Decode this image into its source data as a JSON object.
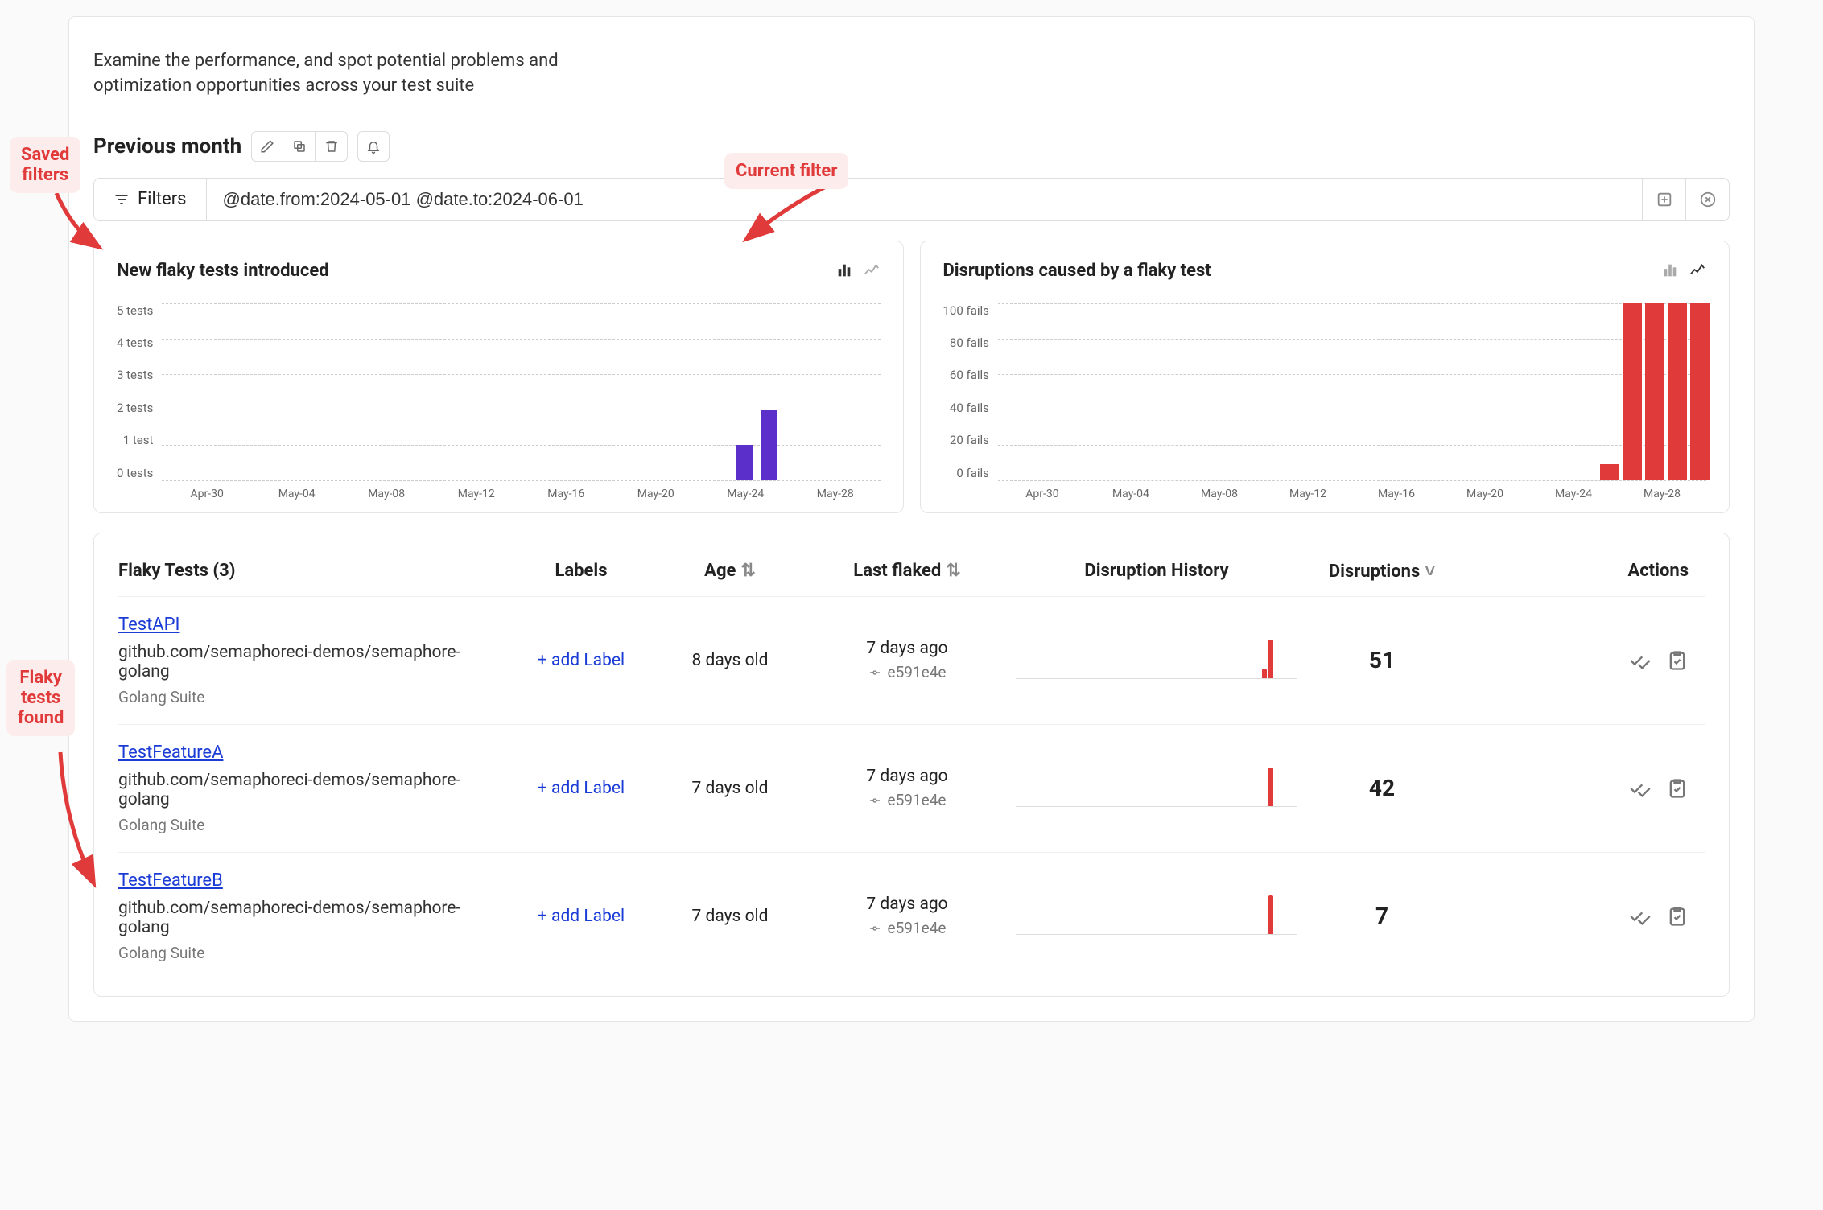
{
  "annotations": {
    "saved_filters": "Saved\nfilters",
    "current_filter": "Current filter",
    "flaky_tests_found": "Flaky\ntests\nfound"
  },
  "intro": "Examine the performance, and spot potential problems and optimization opportunities across your test suite",
  "saved_filter_name": "Previous month",
  "filter_button_label": "Filters",
  "filter_query": "@date.from:2024-05-01 @date.to:2024-06-01",
  "charts": [
    {
      "title": "New flaky tests introduced",
      "active_view": "bar",
      "chart_data": {
        "type": "bar",
        "yticks": [
          "5 tests",
          "4 tests",
          "3 tests",
          "2 tests",
          "1 test",
          "0 tests"
        ],
        "ymax": 5,
        "x_ticks": [
          "Apr-30",
          "May-04",
          "May-08",
          "May-12",
          "May-16",
          "May-20",
          "May-24",
          "May-28"
        ],
        "color": "#5b2fc9",
        "bars": [
          {
            "x_label": "May-27",
            "value": 1
          },
          {
            "x_label": "May-28",
            "value": 2
          }
        ]
      }
    },
    {
      "title": "Disruptions caused by a flaky test",
      "active_view": "line",
      "chart_data": {
        "type": "bar",
        "yticks": [
          "100 fails",
          "80 fails",
          "60 fails",
          "40 fails",
          "20 fails",
          "0 fails"
        ],
        "ymax": 100,
        "x_ticks": [
          "Apr-30",
          "May-04",
          "May-08",
          "May-12",
          "May-16",
          "May-20",
          "May-24",
          "May-28"
        ],
        "color": "#e03a3a",
        "bars": [
          {
            "x_label": "May-27",
            "value": 8
          },
          {
            "x_label": "May-28",
            "value": 100
          },
          {
            "x_label": "May-29",
            "value": 100
          },
          {
            "x_label": "May-30",
            "value": 100
          },
          {
            "x_label": "May-31",
            "value": 100
          }
        ]
      }
    }
  ],
  "table": {
    "title": "Flaky Tests (3)",
    "columns": {
      "labels": "Labels",
      "age": "Age",
      "last_flaked": "Last flaked",
      "history": "Disruption History",
      "disruptions": "Disruptions",
      "actions": "Actions"
    },
    "add_label_text": "+ add Label",
    "rows": [
      {
        "name": "TestAPI",
        "path": "github.com/semaphoreci-demos/semaphore-golang",
        "suite": "Golang Suite",
        "age": "8 days old",
        "last_flaked": "7 days ago",
        "commit": "e591e4e",
        "spike_height": 48,
        "spike_extra": true,
        "disruptions": "51"
      },
      {
        "name": "TestFeatureA",
        "path": "github.com/semaphoreci-demos/semaphore-golang",
        "suite": "Golang Suite",
        "age": "7 days old",
        "last_flaked": "7 days ago",
        "commit": "e591e4e",
        "spike_height": 48,
        "spike_extra": false,
        "disruptions": "42"
      },
      {
        "name": "TestFeatureB",
        "path": "github.com/semaphoreci-demos/semaphore-golang",
        "suite": "Golang Suite",
        "age": "7 days old",
        "last_flaked": "7 days ago",
        "commit": "e591e4e",
        "spike_height": 48,
        "spike_extra": false,
        "disruptions": "7"
      }
    ]
  }
}
